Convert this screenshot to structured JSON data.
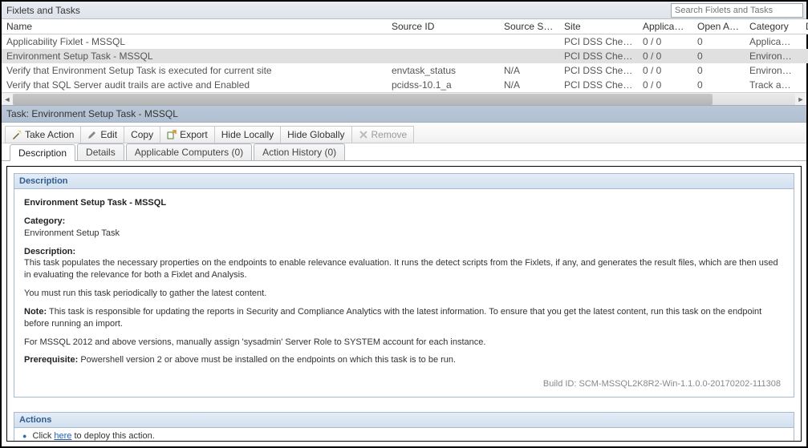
{
  "header": {
    "title": "Fixlets and Tasks",
    "search_placeholder": "Search Fixlets and Tasks"
  },
  "grid": {
    "columns": [
      "Name",
      "Source ID",
      "Source Sev…",
      "Site",
      "Applicable …",
      "Open Actio…",
      "Category",
      "Download …"
    ],
    "rows": [
      {
        "name": "Applicability Fixlet - MSSQL",
        "source_id": "",
        "source_sev": "",
        "site": "PCI DSS Che…",
        "applicable": "0 / 0",
        "open_actions": "0",
        "category": "Applicabilit…",
        "download": ""
      },
      {
        "name": "Environment Setup Task - MSSQL",
        "source_id": "",
        "source_sev": "",
        "site": "PCI DSS Che…",
        "applicable": "0 / 0",
        "open_actions": "0",
        "category": "Environme…",
        "download": "",
        "selected": true
      },
      {
        "name": "Verify that Environment Setup Task is executed for current site",
        "source_id": "envtask_status",
        "source_sev": "N/A",
        "site": "PCI DSS Che…",
        "applicable": "0 / 0",
        "open_actions": "0",
        "category": "Environme…",
        "download": ""
      },
      {
        "name": "Verify that SQL Server audit trails are active and Enabled",
        "source_id": "pcidss-10.1_a",
        "source_sev": "N/A",
        "site": "PCI DSS Che…",
        "applicable": "0 / 0",
        "open_actions": "0",
        "category": "Track and …",
        "download": ""
      }
    ]
  },
  "task_title": "Task: Environment Setup Task - MSSQL",
  "toolbar": {
    "take_action": "Take Action",
    "edit": "Edit",
    "copy": "Copy",
    "export": "Export",
    "hide_locally": "Hide Locally",
    "hide_globally": "Hide Globally",
    "remove": "Remove"
  },
  "tabs": {
    "description": "Description",
    "details": "Details",
    "applicable": "Applicable Computers (0)",
    "action_history": "Action History (0)"
  },
  "description_panel": {
    "heading": "Description",
    "title": "Environment Setup Task - MSSQL",
    "category_label": "Category:",
    "category_value": "Environment Setup Task",
    "desc_label": "Description:",
    "desc_text": "This task populates the necessary properties on the endpoints to enable relevance evaluation. It runs the detect scripts from the Fixlets, if any, and generates the result files, which are then used in evaluating the relevance for both a Fixlet and Analysis.",
    "periodic_text": "You must run this task periodically to gather the latest content.",
    "note_label": "Note:",
    "note_text": "This task is responsible for updating the reports in Security and Compliance Analytics with the latest information. To ensure that you get the latest content, run this task on the endpoint before running an import.",
    "mssql_text": "For MSSQL 2012 and above versions, manually assign 'sysadmin' Server Role to SYSTEM account for each instance.",
    "prereq_label": "Prerequisite:",
    "prereq_text": "Powershell version 2 or above must be installed on the endpoints on which this task is to be run.",
    "build_id": "Build ID: SCM-MSSQL2K8R2-Win-1.1.0.0-20170202-111308"
  },
  "actions_panel": {
    "heading": "Actions",
    "prefix": "Click ",
    "link": "here",
    "suffix": " to deploy this action."
  }
}
